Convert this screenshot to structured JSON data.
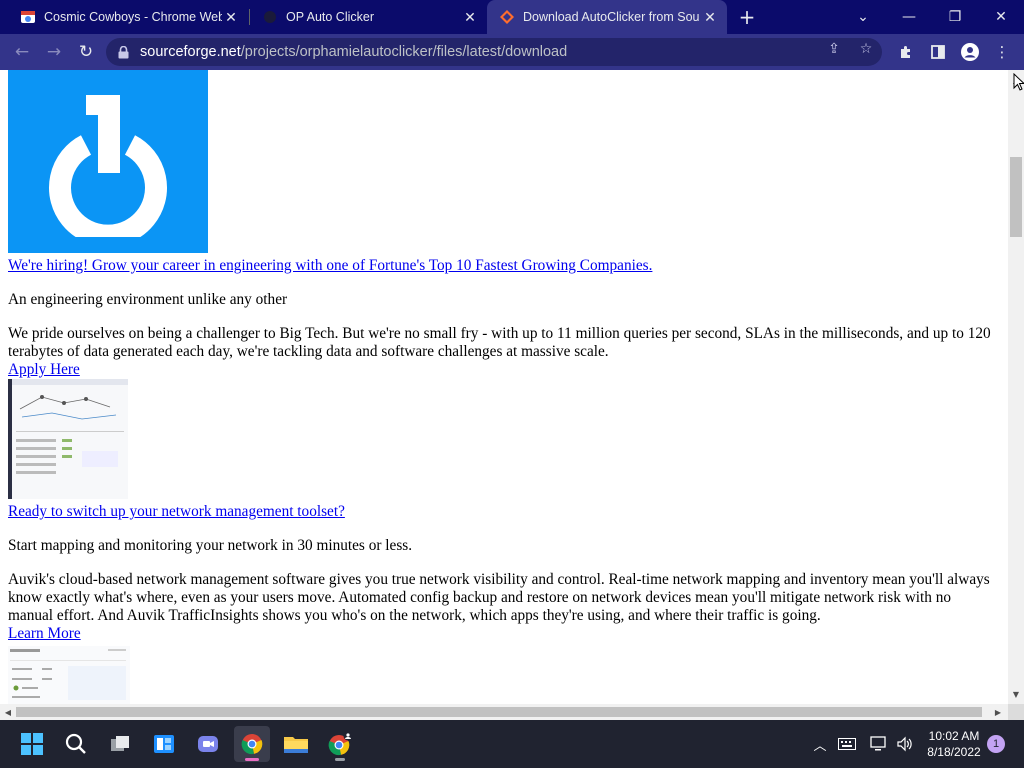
{
  "browser": {
    "tabs": [
      {
        "title": "Cosmic Cowboys - Chrome Web",
        "favicon": "chrome-web-store-icon",
        "active": false
      },
      {
        "title": "OP Auto Clicker",
        "favicon": "auto-clicker-icon",
        "active": false
      },
      {
        "title": "Download AutoClicker from Sou",
        "favicon": "sourceforge-icon",
        "active": true
      }
    ],
    "address": {
      "host": "sourceforge.net",
      "path": "/projects/orphamielautoclicker/files/latest/download"
    },
    "colors": {
      "titlebar": "#0b0b6b",
      "toolbar": "#33348a",
      "active_tab": "#33348a"
    }
  },
  "page": {
    "logo_color": "#0b95f5",
    "ad1": {
      "link": "We're hiring! Grow your career in engineering with one of Fortune's Top 10 Fastest Growing Companies.",
      "subtitle": "An engineering environment unlike any other",
      "body": "We pride ourselves on being a challenger to Big Tech. But we're no small fry - with up to 11 million queries per second, SLAs in the milliseconds, and up to 120 terabytes of data generated each day, we're tackling data and software challenges at massive scale.",
      "cta": "Apply Here"
    },
    "ad2": {
      "link": "Ready to switch up your network management toolset?",
      "subtitle": "Start mapping and monitoring your network in 30 minutes or less.",
      "body": "Auvik's cloud-based network management software gives you true network visibility and control. Real-time network mapping and inventory mean you'll always know exactly what's where, even as your users move. Automated config backup and restore on network devices mean you'll mitigate network risk with no manual effort. And Auvik TrafficInsights shows you who's on the network, which apps they're using, and where their traffic is going.",
      "cta": "Learn More"
    }
  },
  "taskbar": {
    "apps": [
      "start-icon",
      "search-icon",
      "task-view-icon",
      "widgets-icon",
      "teams-chat-icon",
      "chrome-icon",
      "file-explorer-icon",
      "chrome-profile-icon"
    ],
    "time": "10:02 AM",
    "date": "8/18/2022",
    "notification_count": "1"
  }
}
